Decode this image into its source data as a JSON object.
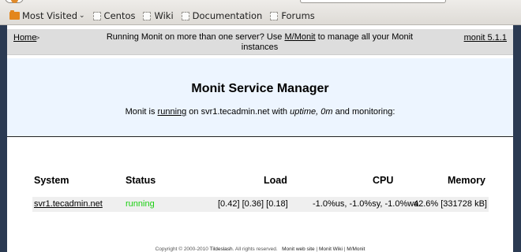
{
  "browser": {
    "bookmarks": [
      {
        "label": "Most Visited",
        "has_dropdown": true,
        "icon": "folder-icon"
      },
      {
        "label": "Centos",
        "icon": "page-icon"
      },
      {
        "label": "Wiki",
        "icon": "page-icon"
      },
      {
        "label": "Documentation",
        "icon": "page-icon"
      },
      {
        "label": "Forums",
        "icon": "page-icon"
      }
    ],
    "dropdown_glyph": "⌄"
  },
  "nav": {
    "home": "Home",
    "separator": ">",
    "msg_before": "Running Monit on more than one server? Use ",
    "mmonit_link": "M/Monit",
    "msg_after": " to manage all your Monit instances",
    "version": "monit 5.1.1"
  },
  "header": {
    "title": "Monit Service Manager",
    "status_prefix": "Monit is ",
    "status_word": "running",
    "status_mid": " on svr1.tecadmin.net with ",
    "uptime": "uptime, 0m",
    "status_suffix": "  and monitoring:"
  },
  "table": {
    "columns": [
      "System",
      "Status",
      "Load",
      "CPU",
      "Memory"
    ],
    "rows": [
      {
        "system": "svr1.tecadmin.net",
        "status": "running",
        "load": "[0.42] [0.36] [0.18]",
        "cpu": "-1.0%us, -1.0%sy, -1.0%wa",
        "memory": "42.6% [331728 kB]"
      }
    ]
  },
  "footer": {
    "copyright": "Copyright © 2000-2010 ",
    "tildeslash": "Tildeslash",
    "rights": ". All rights reserved.",
    "sep_gap": "   ",
    "link1": "Monit web site",
    "sep": " | ",
    "link2": "Monit Wiki",
    "link3": "M/Monit"
  },
  "colors": {
    "running": "#19cf0f",
    "header_bg": "#edf5ff",
    "nav_bg": "#dddddd",
    "row_bg": "#efefef"
  }
}
